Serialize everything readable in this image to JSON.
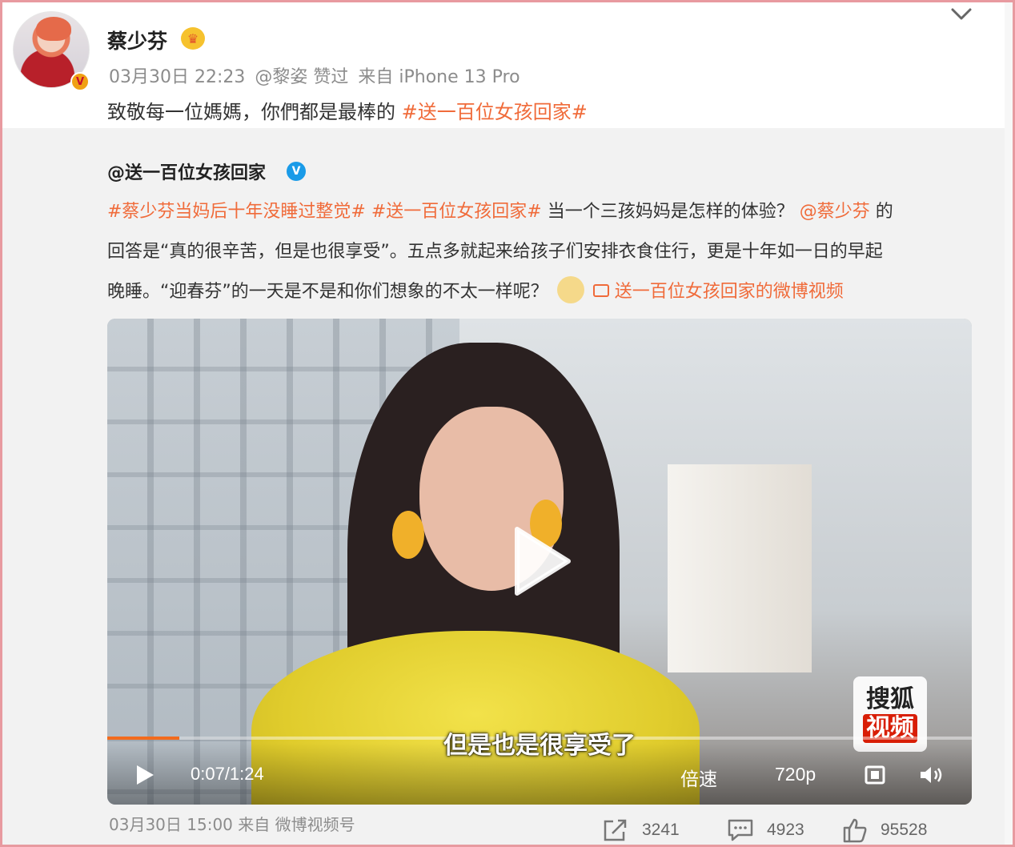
{
  "post": {
    "user_name": "蔡少芬",
    "verified_badge": "V",
    "crown_glyph": "♛",
    "time": "03月30日 22:23",
    "liked_by": "@黎姿 赞过",
    "source": "来自 iPhone 13 Pro",
    "text_plain": "致敬每一位媽媽，你們都是最棒的 ",
    "text_topic": "#送一百位女孩回家#"
  },
  "repost": {
    "author": "@送一百位女孩回家",
    "author_verified": "V",
    "line1_topic1": "#蔡少芬当妈后十年没睡过整觉#",
    "line1_topic2": "#送一百位女孩回家#",
    "line1_text": " 当一个三孩妈妈是怎样的体验？",
    "line1_mention": "@蔡少芬",
    "line1_tail": " 的",
    "line2_text": "回答是“真的很辛苦，但是也很享受”。五点多就起来给孩子们安排衣食住行，更是十年如一日的早起",
    "line3_text": "晚睡。“迎春芬”的一天是不是和你们想象的不太一样呢？",
    "line3_link": "送一百位女孩回家的微博视频",
    "footer_time": "03月30日 15:00",
    "footer_source": "来自 微博视频号"
  },
  "video": {
    "subtitle": "但是也是很享受了",
    "time": "0:07/1:24",
    "progress": 0.0833,
    "speed_label": "倍速",
    "quality_label": "720p",
    "watermark_top": "搜狐",
    "watermark_bottom": "视频"
  },
  "actions": {
    "share_count": "3241",
    "comment_count": "4923",
    "like_count": "95528"
  },
  "colors": {
    "link": "#f06b3a",
    "progress": "#f26b1d",
    "verified_blue": "#1a9be8",
    "verified_gold": "#f0a014"
  },
  "icons": {
    "expand": "chevron-down-icon",
    "play_big": "play-icon",
    "play_small": "play-icon",
    "fullscreen": "fullscreen-icon",
    "volume": "volume-icon",
    "share": "share-icon",
    "comment": "comment-icon",
    "like": "thumbs-up-icon",
    "emoji": "doge-emoji-icon",
    "video_link": "video-link-icon"
  }
}
